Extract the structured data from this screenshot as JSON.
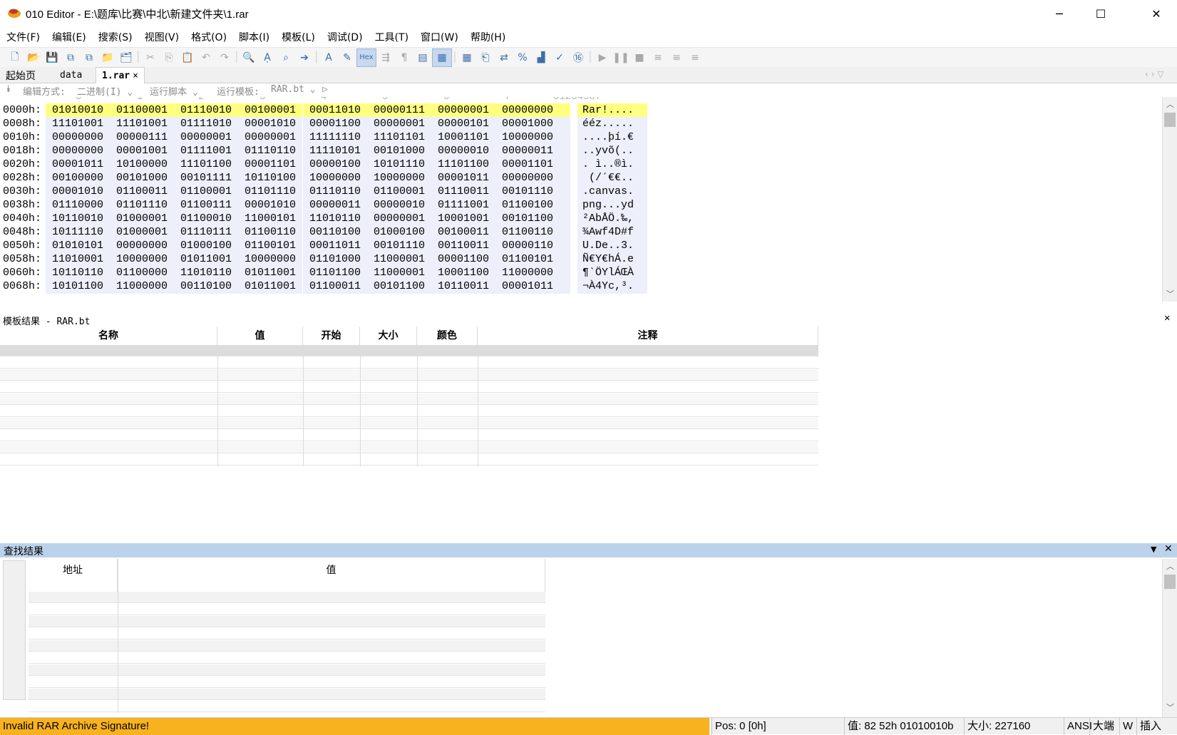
{
  "window": {
    "title": "010 Editor - E:\\题库\\比赛\\中北\\新建文件夹\\1.rar",
    "minimize_glyph": "─",
    "maximize_glyph": "☐",
    "close_glyph": "✕"
  },
  "menu": [
    "文件(F)",
    "编辑(E)",
    "搜索(S)",
    "视图(V)",
    "格式(O)",
    "脚本(I)",
    "模板(L)",
    "调试(D)",
    "工具(T)",
    "窗口(W)",
    "帮助(H)"
  ],
  "toolbar": {
    "icons": [
      "new-file-icon",
      "open-folder-icon",
      "save-icon",
      "save-as-icon",
      "save-all-icon",
      "open-dir-icon",
      "workspace-icon",
      "cut-icon",
      "copy-icon",
      "paste-icon",
      "undo-icon",
      "redo-icon",
      "find-icon",
      "replace-icon",
      "find-in-files-icon",
      "goto-icon",
      "font-icon",
      "highlight-icon",
      "hex-mode-icon",
      "wrap-icon",
      "paragraph-icon",
      "columns-icon",
      "binary-mode-icon",
      "calculator-icon",
      "compare-icon",
      "swap-icon",
      "percent-icon",
      "histogram-icon",
      "checksum-icon",
      "base-convert-icon",
      "run-icon",
      "pause-icon",
      "stop-icon",
      "step-icon",
      "step-into-icon",
      "step-out-icon"
    ],
    "hex_label": "Hex"
  },
  "tabs": [
    "起始页",
    "data",
    "1.rar"
  ],
  "tab_close": "×",
  "editor_bar": {
    "edit_mode_label": "编辑方式:",
    "edit_mode_value": "二进制(I)",
    "run_script_label": "运行脚本",
    "run_template_label": "运行模板:",
    "run_template_value": "RAR.bt"
  },
  "ruler": [
    "0",
    "1",
    "2",
    "3",
    "4",
    "5",
    "6",
    "7"
  ],
  "ruler_chars": "01234567",
  "hex_rows": [
    {
      "addr": "0000h:",
      "bytes": [
        "01010010",
        "01100001",
        "01110010",
        "00100001",
        "00011010",
        "00000111",
        "00000001",
        "00000000"
      ],
      "chars": "Rar!...."
    },
    {
      "addr": "0008h:",
      "bytes": [
        "11101001",
        "11101001",
        "01111010",
        "00001010",
        "00001100",
        "00000001",
        "00000101",
        "00001000"
      ],
      "chars": "ééz....."
    },
    {
      "addr": "0010h:",
      "bytes": [
        "00000000",
        "00000111",
        "00000001",
        "00000001",
        "11111110",
        "11101101",
        "10001101",
        "10000000"
      ],
      "chars": "....þí.€"
    },
    {
      "addr": "0018h:",
      "bytes": [
        "00000000",
        "00001001",
        "01111001",
        "01110110",
        "11110101",
        "00101000",
        "00000010",
        "00000011"
      ],
      "chars": "..yvõ(.."
    },
    {
      "addr": "0020h:",
      "bytes": [
        "00001011",
        "10100000",
        "11101100",
        "00001101",
        "00000100",
        "10101110",
        "11101100",
        "00001101"
      ],
      "chars": ". ì..®ì."
    },
    {
      "addr": "0028h:",
      "bytes": [
        "00100000",
        "00101000",
        "00101111",
        "10110100",
        "10000000",
        "10000000",
        "00001011",
        "00000000"
      ],
      "chars": " (/´€€.."
    },
    {
      "addr": "0030h:",
      "bytes": [
        "00001010",
        "01100011",
        "01100001",
        "01101110",
        "01110110",
        "01100001",
        "01110011",
        "00101110"
      ],
      "chars": ".canvas."
    },
    {
      "addr": "0038h:",
      "bytes": [
        "01110000",
        "01101110",
        "01100111",
        "00001010",
        "00000011",
        "00000010",
        "01111001",
        "01100100"
      ],
      "chars": "png...yd"
    },
    {
      "addr": "0040h:",
      "bytes": [
        "10110010",
        "01000001",
        "01100010",
        "11000101",
        "11010110",
        "00000001",
        "10001001",
        "00101100"
      ],
      "chars": "²AbÅÖ.‰,"
    },
    {
      "addr": "0048h:",
      "bytes": [
        "10111110",
        "01000001",
        "01110111",
        "01100110",
        "00110100",
        "01000100",
        "00100011",
        "01100110"
      ],
      "chars": "¾Awf4D#f"
    },
    {
      "addr": "0050h:",
      "bytes": [
        "01010101",
        "00000000",
        "01000100",
        "01100101",
        "00011011",
        "00101110",
        "00110011",
        "00000110"
      ],
      "chars": "U.De..3."
    },
    {
      "addr": "0058h:",
      "bytes": [
        "11010001",
        "10000000",
        "01011001",
        "10000000",
        "01101000",
        "11000001",
        "00001100",
        "01100101"
      ],
      "chars": "Ñ€Y€hÁ.e"
    },
    {
      "addr": "0060h:",
      "bytes": [
        "10110110",
        "01100000",
        "11010110",
        "01011001",
        "01101100",
        "11000001",
        "10001100",
        "11000000"
      ],
      "chars": "¶`ÖYlÁŒÀ"
    },
    {
      "addr": "0068h:",
      "bytes": [
        "10101100",
        "11000000",
        "00110100",
        "01011001",
        "01100011",
        "00101100",
        "10110011",
        "00001011"
      ],
      "chars": "¬À4Yc,³."
    }
  ],
  "template_panel": {
    "title": "模板结果 - RAR.bt",
    "columns": [
      "名称",
      "值",
      "开始",
      "大小",
      "颜色",
      "注释"
    ]
  },
  "find_panel": {
    "title": "查找结果",
    "columns": [
      "地址",
      "值"
    ]
  },
  "status": {
    "message": "Invalid RAR Archive Signature!",
    "pos": "Pos: 0 [0h]",
    "value": "值: 82 52h 01010010b",
    "size": "大小: 227160",
    "encoding": "ANSI",
    "endian": "大端",
    "width_mode": "W",
    "insert_mode": "插入"
  },
  "colors": {
    "selection": "#ffff80",
    "byte_band": "#edf0fb",
    "status_warning": "#f8b21f",
    "find_header": "#bcd2ea"
  }
}
